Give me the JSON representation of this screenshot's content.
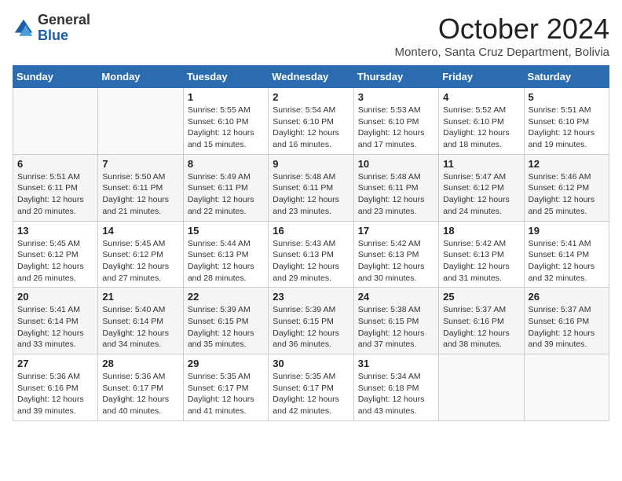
{
  "logo": {
    "general": "General",
    "blue": "Blue"
  },
  "header": {
    "month": "October 2024",
    "location": "Montero, Santa Cruz Department, Bolivia"
  },
  "days_of_week": [
    "Sunday",
    "Monday",
    "Tuesday",
    "Wednesday",
    "Thursday",
    "Friday",
    "Saturday"
  ],
  "weeks": [
    [
      {
        "day": "",
        "info": ""
      },
      {
        "day": "",
        "info": ""
      },
      {
        "day": "1",
        "info": "Sunrise: 5:55 AM\nSunset: 6:10 PM\nDaylight: 12 hours and 15 minutes."
      },
      {
        "day": "2",
        "info": "Sunrise: 5:54 AM\nSunset: 6:10 PM\nDaylight: 12 hours and 16 minutes."
      },
      {
        "day": "3",
        "info": "Sunrise: 5:53 AM\nSunset: 6:10 PM\nDaylight: 12 hours and 17 minutes."
      },
      {
        "day": "4",
        "info": "Sunrise: 5:52 AM\nSunset: 6:10 PM\nDaylight: 12 hours and 18 minutes."
      },
      {
        "day": "5",
        "info": "Sunrise: 5:51 AM\nSunset: 6:10 PM\nDaylight: 12 hours and 19 minutes."
      }
    ],
    [
      {
        "day": "6",
        "info": "Sunrise: 5:51 AM\nSunset: 6:11 PM\nDaylight: 12 hours and 20 minutes."
      },
      {
        "day": "7",
        "info": "Sunrise: 5:50 AM\nSunset: 6:11 PM\nDaylight: 12 hours and 21 minutes."
      },
      {
        "day": "8",
        "info": "Sunrise: 5:49 AM\nSunset: 6:11 PM\nDaylight: 12 hours and 22 minutes."
      },
      {
        "day": "9",
        "info": "Sunrise: 5:48 AM\nSunset: 6:11 PM\nDaylight: 12 hours and 23 minutes."
      },
      {
        "day": "10",
        "info": "Sunrise: 5:48 AM\nSunset: 6:11 PM\nDaylight: 12 hours and 23 minutes."
      },
      {
        "day": "11",
        "info": "Sunrise: 5:47 AM\nSunset: 6:12 PM\nDaylight: 12 hours and 24 minutes."
      },
      {
        "day": "12",
        "info": "Sunrise: 5:46 AM\nSunset: 6:12 PM\nDaylight: 12 hours and 25 minutes."
      }
    ],
    [
      {
        "day": "13",
        "info": "Sunrise: 5:45 AM\nSunset: 6:12 PM\nDaylight: 12 hours and 26 minutes."
      },
      {
        "day": "14",
        "info": "Sunrise: 5:45 AM\nSunset: 6:12 PM\nDaylight: 12 hours and 27 minutes."
      },
      {
        "day": "15",
        "info": "Sunrise: 5:44 AM\nSunset: 6:13 PM\nDaylight: 12 hours and 28 minutes."
      },
      {
        "day": "16",
        "info": "Sunrise: 5:43 AM\nSunset: 6:13 PM\nDaylight: 12 hours and 29 minutes."
      },
      {
        "day": "17",
        "info": "Sunrise: 5:42 AM\nSunset: 6:13 PM\nDaylight: 12 hours and 30 minutes."
      },
      {
        "day": "18",
        "info": "Sunrise: 5:42 AM\nSunset: 6:13 PM\nDaylight: 12 hours and 31 minutes."
      },
      {
        "day": "19",
        "info": "Sunrise: 5:41 AM\nSunset: 6:14 PM\nDaylight: 12 hours and 32 minutes."
      }
    ],
    [
      {
        "day": "20",
        "info": "Sunrise: 5:41 AM\nSunset: 6:14 PM\nDaylight: 12 hours and 33 minutes."
      },
      {
        "day": "21",
        "info": "Sunrise: 5:40 AM\nSunset: 6:14 PM\nDaylight: 12 hours and 34 minutes."
      },
      {
        "day": "22",
        "info": "Sunrise: 5:39 AM\nSunset: 6:15 PM\nDaylight: 12 hours and 35 minutes."
      },
      {
        "day": "23",
        "info": "Sunrise: 5:39 AM\nSunset: 6:15 PM\nDaylight: 12 hours and 36 minutes."
      },
      {
        "day": "24",
        "info": "Sunrise: 5:38 AM\nSunset: 6:15 PM\nDaylight: 12 hours and 37 minutes."
      },
      {
        "day": "25",
        "info": "Sunrise: 5:37 AM\nSunset: 6:16 PM\nDaylight: 12 hours and 38 minutes."
      },
      {
        "day": "26",
        "info": "Sunrise: 5:37 AM\nSunset: 6:16 PM\nDaylight: 12 hours and 39 minutes."
      }
    ],
    [
      {
        "day": "27",
        "info": "Sunrise: 5:36 AM\nSunset: 6:16 PM\nDaylight: 12 hours and 39 minutes."
      },
      {
        "day": "28",
        "info": "Sunrise: 5:36 AM\nSunset: 6:17 PM\nDaylight: 12 hours and 40 minutes."
      },
      {
        "day": "29",
        "info": "Sunrise: 5:35 AM\nSunset: 6:17 PM\nDaylight: 12 hours and 41 minutes."
      },
      {
        "day": "30",
        "info": "Sunrise: 5:35 AM\nSunset: 6:17 PM\nDaylight: 12 hours and 42 minutes."
      },
      {
        "day": "31",
        "info": "Sunrise: 5:34 AM\nSunset: 6:18 PM\nDaylight: 12 hours and 43 minutes."
      },
      {
        "day": "",
        "info": ""
      },
      {
        "day": "",
        "info": ""
      }
    ]
  ]
}
